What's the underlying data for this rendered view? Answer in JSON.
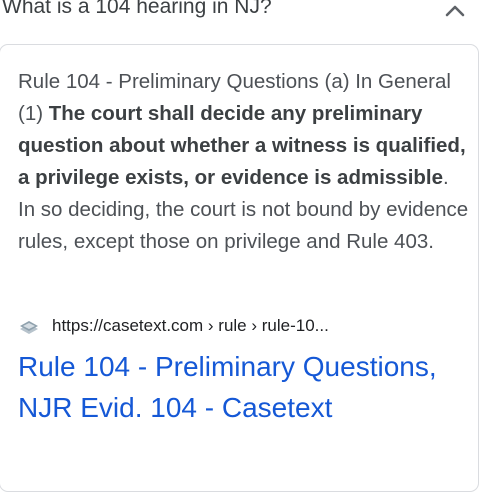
{
  "question": {
    "text": "What is a 104 hearing in NJ?",
    "toggle_icon": "chevron-up-icon"
  },
  "answer": {
    "lead": "Rule 104 - Preliminary Questions (a) In General (1) ",
    "bold": "The court shall decide any preliminary question about whether a witness is qualified, a privilege exists, or evidence is admissible",
    "rest": ". In so deciding, the court is not bound by evidence rules, except those on privilege and Rule 403."
  },
  "source": {
    "favicon": "casetext-favicon-icon",
    "url": "https://casetext.com › rule › rule-10..."
  },
  "result": {
    "title": "Rule 104 - Preliminary Questions, NJR Evid. 104 - Casetext"
  },
  "colors": {
    "link": "#1558d6",
    "body_text": "#4d5156",
    "border": "#dadce0"
  }
}
